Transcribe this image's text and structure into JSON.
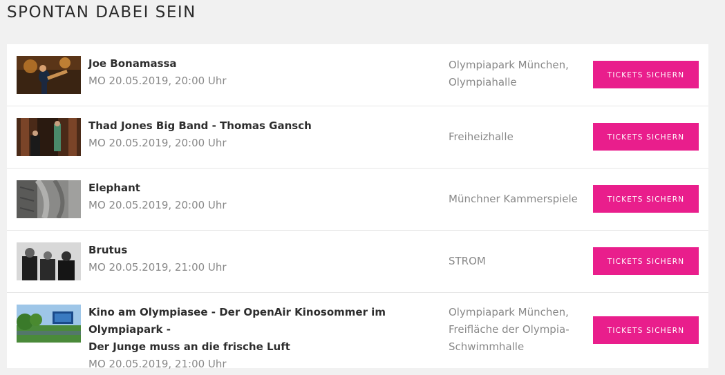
{
  "section_title": "SPONTAN DABEI SEIN",
  "events": [
    {
      "title": "Joe Bonamassa",
      "date": "MO 20.05.2019, 20:00 Uhr",
      "venue_lines": [
        "Olympiapark München,",
        "Olympiahalle"
      ],
      "button": "TICKETS SICHERN",
      "thumb": "concert-guitarist-photo"
    },
    {
      "title": "Thad Jones Big Band - Thomas Gansch",
      "date": "MO 20.05.2019, 20:00 Uhr",
      "venue_lines": [
        "Freiheizhalle"
      ],
      "button": "TICKETS SICHERN",
      "thumb": "musicians-doorway-photo"
    },
    {
      "title": "Elephant",
      "date": "MO 20.05.2019, 20:00 Uhr",
      "venue_lines": [
        "Münchner Kammerspiele"
      ],
      "button": "TICKETS SICHERN",
      "thumb": "elephant-skin-photo"
    },
    {
      "title": "Brutus",
      "date": "MO 20.05.2019, 21:00 Uhr",
      "venue_lines": [
        "STROM"
      ],
      "button": "TICKETS SICHERN",
      "thumb": "band-portrait-photo"
    },
    {
      "title_lines": [
        "Kino am Olympiasee - Der OpenAir Kinosommer im Olympiapark -",
        "Der Junge muss an die frische Luft"
      ],
      "date": "MO 20.05.2019, 21:00 Uhr",
      "venue_lines": [
        "Olympiapark München,",
        "Freifläche der Olympia-",
        "Schwimmhalle"
      ],
      "button": "TICKETS SICHERN",
      "thumb": "open-air-cinema-photo"
    }
  ],
  "colors": {
    "accent": "#e91e8c",
    "background": "#f1f1f1"
  }
}
